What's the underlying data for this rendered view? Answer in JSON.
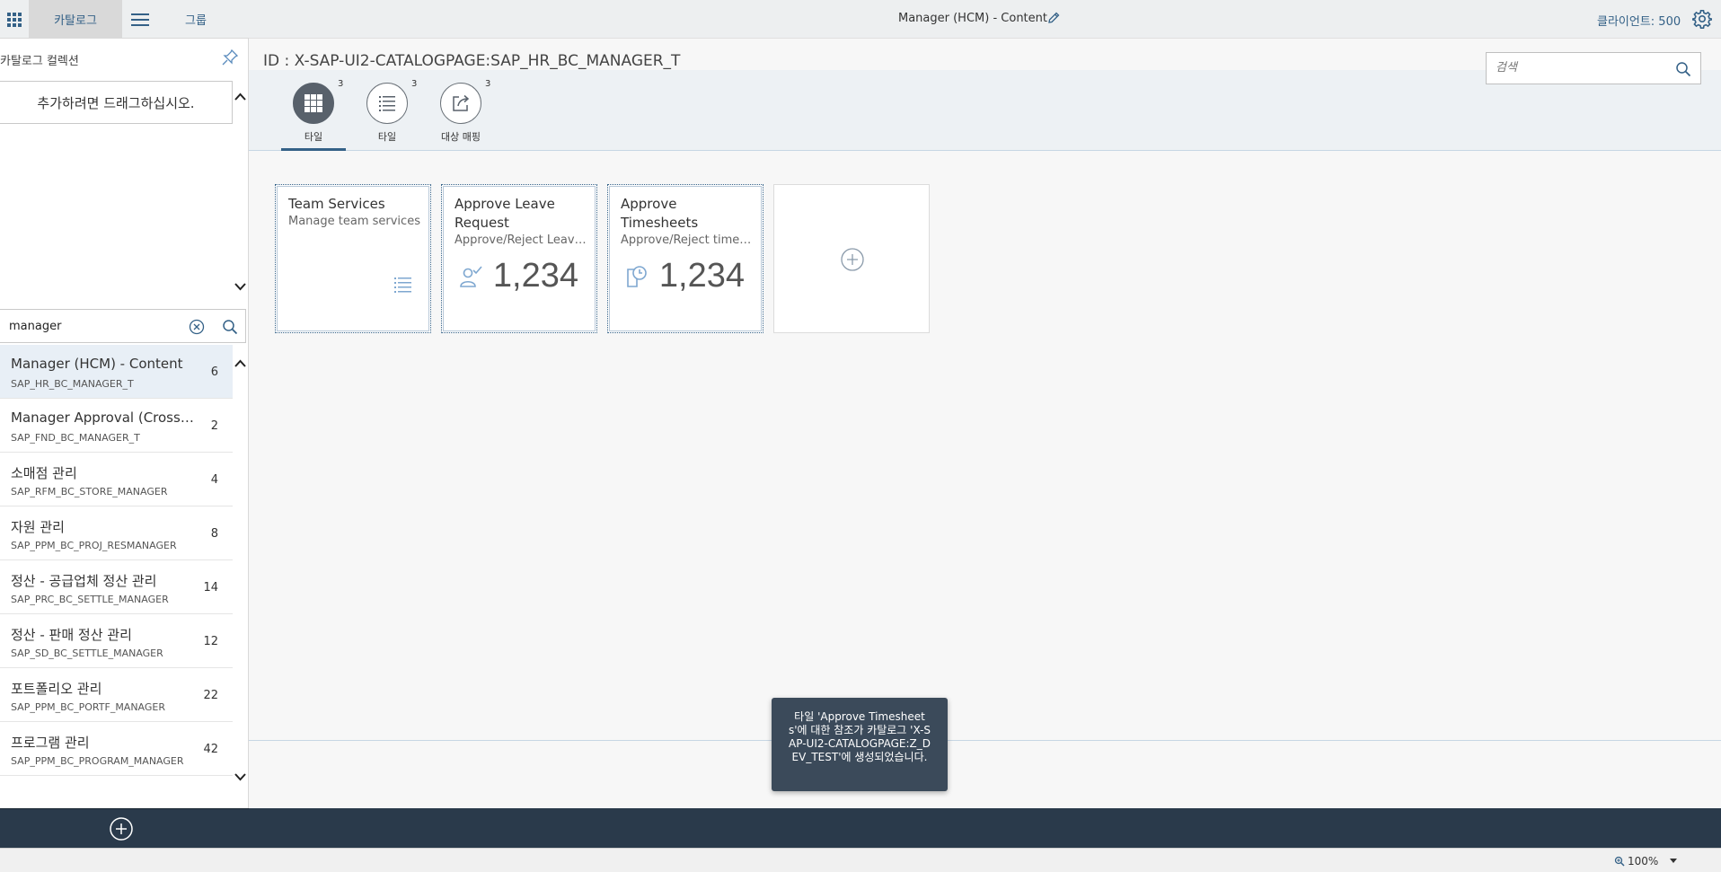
{
  "sidebar": {
    "tabs": {
      "catalog": "카탈로그",
      "group": "그룹"
    },
    "collection_title": "카탈로그 컬렉션",
    "drop_hint": "추가하려면 드래그하십시오.",
    "search_value": "manager",
    "catalogs": [
      {
        "title": "Manager (HCM) - Content",
        "id": "SAP_HR_BC_MANAGER_T",
        "count": "6",
        "selected": true
      },
      {
        "title": "Manager Approval (Cross) - Content",
        "id": "SAP_FND_BC_MANAGER_T",
        "count": "2"
      },
      {
        "title": "소매점 관리",
        "id": "SAP_RFM_BC_STORE_MANAGER",
        "count": "4"
      },
      {
        "title": "자원 관리",
        "id": "SAP_PPM_BC_PROJ_RESMANAGER",
        "count": "8"
      },
      {
        "title": "정산 - 공급업체 정산 관리",
        "id": "SAP_PRC_BC_SETTLE_MANAGER",
        "count": "14"
      },
      {
        "title": "정산 - 판매 정산 관리",
        "id": "SAP_SD_BC_SETTLE_MANAGER",
        "count": "12"
      },
      {
        "title": "포트폴리오 관리",
        "id": "SAP_PPM_BC_PORTF_MANAGER",
        "count": "22"
      },
      {
        "title": "프로그램 관리",
        "id": "SAP_PPM_BC_PROGRAM_MANAGER",
        "count": "42"
      }
    ]
  },
  "header": {
    "title": "Manager (HCM) - Content",
    "client": "클라이언트: 500",
    "search_placeholder": "검색"
  },
  "catalog_id": "ID : X-SAP-UI2-CATALOGPAGE:SAP_HR_BC_MANAGER_T",
  "icon_tabs": [
    {
      "label": "타일",
      "badge": "3",
      "icon": "grid-icon",
      "active": true
    },
    {
      "label": "타일",
      "badge": "3",
      "icon": "list-icon"
    },
    {
      "label": "대상 매핑",
      "badge": "3",
      "icon": "share-icon"
    }
  ],
  "tiles": [
    {
      "title": "Team Services",
      "subtitle": "Manage team services",
      "icon": "list-icon"
    },
    {
      "title": "Approve Leave Request",
      "subtitle": "Approve/Reject Leave Requests",
      "number": "1,234",
      "icon": "person-check-icon"
    },
    {
      "title": "Approve Timesheets",
      "subtitle": "Approve/Reject timesheets",
      "number": "1,234",
      "icon": "timesheet-icon"
    }
  ],
  "toast": "타일 'Approve Timesheets'에 대한 참조가 카탈로그 'X-SAP-UI2-CATALOGPAGE:Z_DEV_TEST'에 생성되었습니다.",
  "status_bar": {
    "zoom": "100%"
  },
  "colors": {
    "accent": "#346187",
    "dark_bar": "#2a3a4b",
    "toast_bg": "#3b4a5a"
  }
}
